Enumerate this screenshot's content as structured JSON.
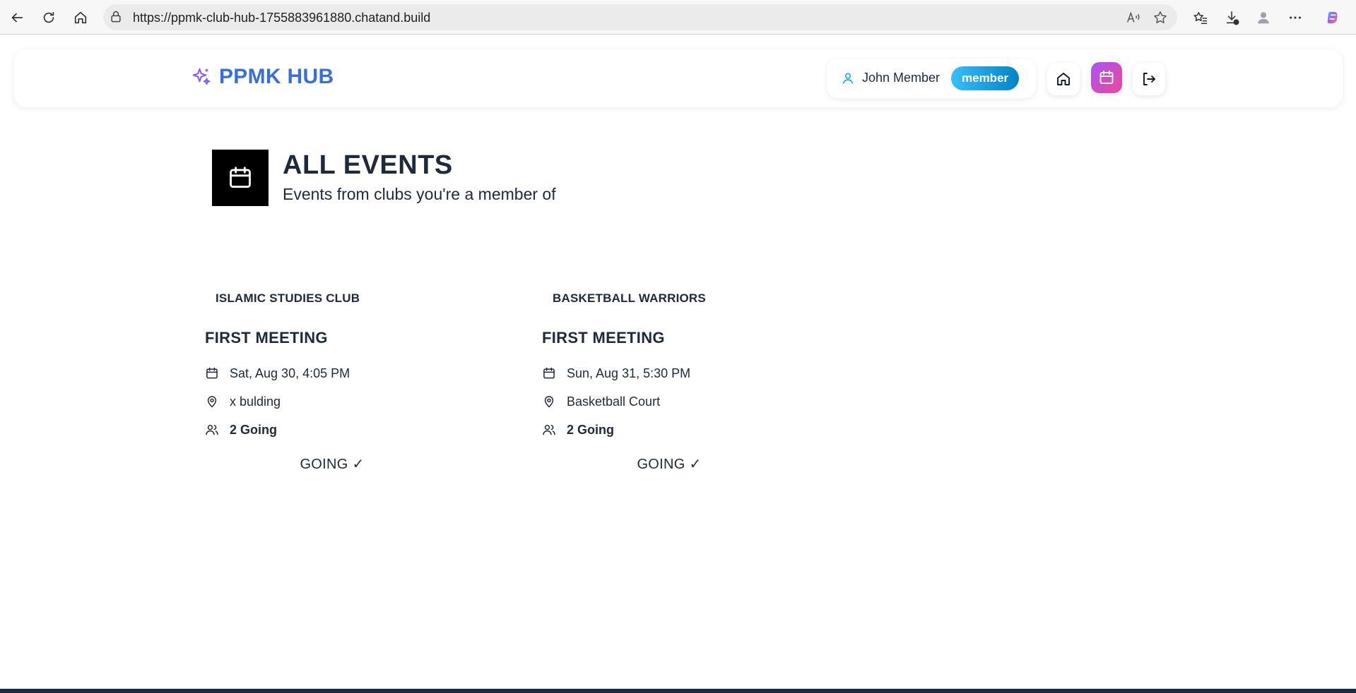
{
  "browser": {
    "url": "https://ppmk-club-hub-1755883961880.chatand.build"
  },
  "header": {
    "brand": "PPMK HUB",
    "user_name": "John Member",
    "role": "member"
  },
  "page": {
    "title": "ALL EVENTS",
    "subtitle": "Events from clubs you're a member of"
  },
  "events": [
    {
      "club": "ISLAMIC STUDIES CLUB",
      "title": "FIRST MEETING",
      "datetime": "Sat, Aug 30, 4:05 PM",
      "location": "x bulding",
      "attendees": "2 Going",
      "rsvp_label": "GOING ✓"
    },
    {
      "club": "BASKETBALL WARRIORS",
      "title": "FIRST MEETING",
      "datetime": "Sun, Aug 31, 5:30 PM",
      "location": "Basketball Court",
      "attendees": "2 Going",
      "rsvp_label": "GOING ✓"
    }
  ],
  "colors": {
    "brand_blue": "#3b6fd8",
    "accent_purple": "#a855f7",
    "badge_blue": "#0ea5e9",
    "text_dark": "#1e293b"
  }
}
